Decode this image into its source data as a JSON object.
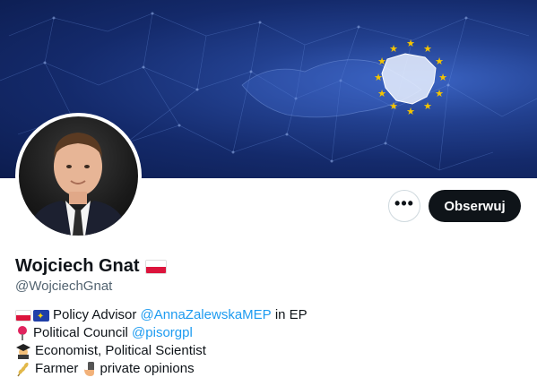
{
  "profile": {
    "name": "Wojciech Gnat",
    "handle": "@WojciechGnat",
    "follow_label": "Obserwuj",
    "more_label": "•••"
  },
  "bio": {
    "line1": {
      "text_before": "Policy Advisor ",
      "mention": "@AnnaZalewskaMEP",
      "text_after": " in EP"
    },
    "line2": {
      "text_before": "Political Council ",
      "mention": "@pisorgpl"
    },
    "line3": {
      "text": "Economist, Political Scientist"
    },
    "line4": {
      "text_a": "Farmer ",
      "text_b": "private opinions"
    }
  },
  "icons": [
    "flag-poland-icon",
    "flag-eu-icon",
    "pin-icon",
    "graduate-icon",
    "wheat-icon",
    "phone-in-hand-icon",
    "more-icon"
  ],
  "colors": {
    "accent": "#1d9bf0",
    "button_dark": "#0f1419",
    "muted": "#536471",
    "banner_blue": "#22408f",
    "flag_red": "#dc143c"
  }
}
